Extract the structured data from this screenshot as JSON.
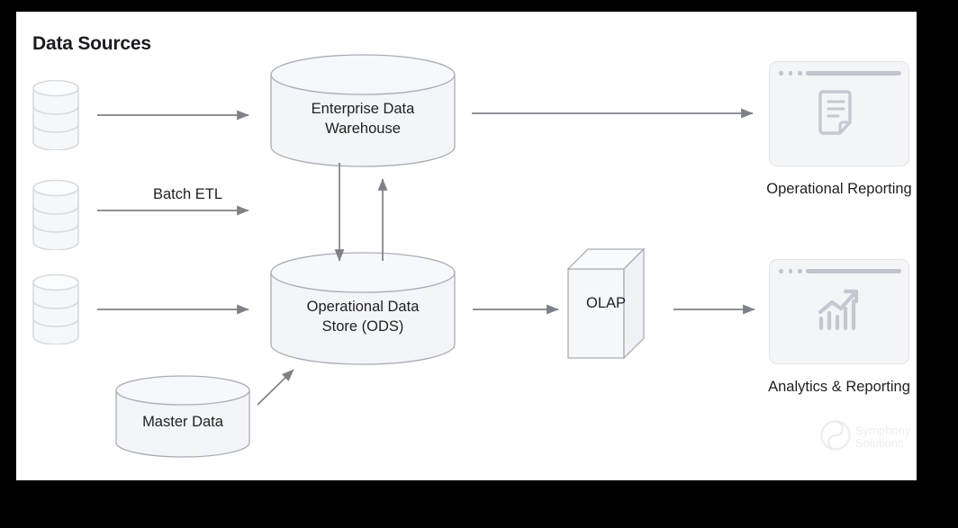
{
  "diagram": {
    "title": "Data Sources",
    "background_color": "#ffffff",
    "frame_color": "#000000",
    "shape_fill": "#f4f5f8",
    "shape_stroke": "#aaaeb5",
    "arrow_color": "#7e8288",
    "text_color": "#1f2024"
  },
  "sources": [
    {
      "name": "source-database-1"
    },
    {
      "name": "source-database-2"
    },
    {
      "name": "source-database-3"
    }
  ],
  "nodes": {
    "edw": {
      "label_line1": "Enterprise Data",
      "label_line2": "Warehouse"
    },
    "ods": {
      "label_line1": "Operational Data",
      "label_line2": "Store (ODS)"
    },
    "master_data": {
      "label": "Master Data"
    },
    "olap": {
      "label": "OLAP"
    }
  },
  "cards": [
    {
      "caption": "Operational Reporting",
      "icon": "document-icon"
    },
    {
      "caption": "Analytics & Reporting",
      "icon": "bar-chart-icon"
    }
  ],
  "edges": [
    {
      "from": "source-database-1",
      "to": "edw",
      "label": ""
    },
    {
      "from": "source-database-2",
      "to": "edw",
      "label": "Batch ETL"
    },
    {
      "from": "source-database-3",
      "to": "ods",
      "label": ""
    },
    {
      "from": "master-data",
      "to": "ods",
      "label": ""
    },
    {
      "from": "edw",
      "to": "ods",
      "label": ""
    },
    {
      "from": "ods",
      "to": "edw",
      "label": ""
    },
    {
      "from": "edw",
      "to": "operational-reporting",
      "label": ""
    },
    {
      "from": "ods",
      "to": "olap",
      "label": ""
    },
    {
      "from": "olap",
      "to": "analytics-reporting",
      "label": ""
    }
  ],
  "labels": {
    "batch_etl": "Batch ETL"
  },
  "watermark": {
    "line1": "Symphony",
    "line2": "Solutions"
  }
}
